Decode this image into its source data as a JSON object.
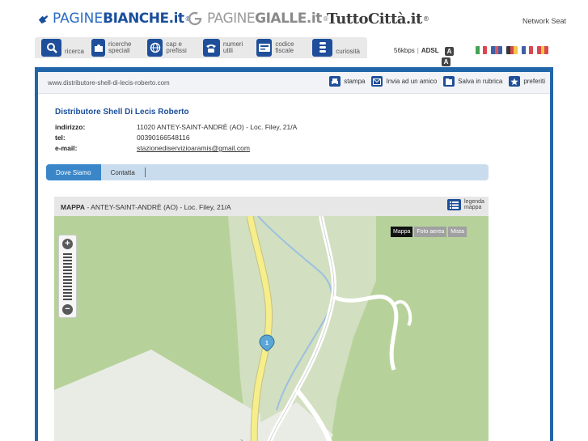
{
  "brands": {
    "paginebianche": {
      "pre": "PAGINE",
      "main": "BIANCHE",
      "suffix": ".it",
      "reg": "®"
    },
    "paginegialle": {
      "pre": "PAGINE",
      "main": "GIALLE",
      "suffix": ".it",
      "reg": "®"
    },
    "tuttocitta": {
      "text": "TuttoCittà.it",
      "reg": "®"
    }
  },
  "network_seat": "Network Seat",
  "nav": [
    {
      "label": "ricerca",
      "icon": "magnifier-icon"
    },
    {
      "label": "ricerche speciali",
      "icon": "puzzle-icon"
    },
    {
      "label": "cap e prefissi",
      "icon": "globe-icon"
    },
    {
      "label": "numeri utili",
      "icon": "phone-icon"
    },
    {
      "label": "codice fiscale",
      "icon": "id-card-icon"
    },
    {
      "label": "curiosità",
      "icon": "spring-icon"
    }
  ],
  "speed": {
    "kbps": "56kbps",
    "adsl": "ADSL",
    "text_small": "A",
    "text_large": "A"
  },
  "languages": [
    {
      "code": "it",
      "colors": [
        "#2f9a43",
        "#ffffff",
        "#d8343b"
      ]
    },
    {
      "code": "en",
      "colors": [
        "#2b4f9c",
        "#e04444",
        "#2b4f9c"
      ]
    },
    {
      "code": "de",
      "colors": [
        "#222222",
        "#d8343b",
        "#f2c230"
      ]
    },
    {
      "code": "fr",
      "colors": [
        "#2b4f9c",
        "#ffffff",
        "#d8343b"
      ]
    },
    {
      "code": "es",
      "colors": [
        "#d8343b",
        "#f2c230",
        "#d8343b"
      ]
    }
  ],
  "url": "www.distributore-shell-di-lecis-roberto.com",
  "actions": {
    "print": "stampa",
    "send": "Invia ad un amico",
    "save": "Salva in rubrica",
    "favorites": "preferiti"
  },
  "business": {
    "name": "Distributore Shell Di Lecis Roberto",
    "address_label": "indirizzo:",
    "address": "11020 ANTEY-SAINT-ANDRÈ (AO) - Loc. Filey, 21/A",
    "phone_label": "tel:",
    "phone": "00390166548116",
    "email_label": "e-mail:",
    "email": "stazionediservizioaramis@gmail.com"
  },
  "tabs": {
    "where": "Dove Siamo",
    "contact": "Contatta"
  },
  "map": {
    "title": "MAPPA",
    "address": "- ANTEY-SAINT-ANDRÈ (AO) - Loc. Filey, 21/A",
    "legend": "legenda mappa",
    "types": [
      "Mappa",
      "Foto aerea",
      "Mista"
    ],
    "marker_label": "1",
    "road_label": "ey"
  },
  "colors": {
    "brand_blue": "#1f4f9a",
    "panel_border": "#2266aa",
    "tab_active": "#3a86c8",
    "road_yellow": "#f5ee8a",
    "marker": "#5aa7d6"
  }
}
